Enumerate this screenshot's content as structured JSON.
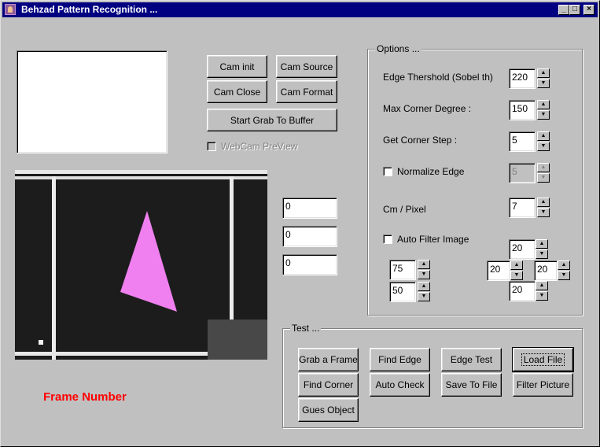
{
  "window": {
    "title": "Behzad Pattern Recognition ...",
    "controls": {
      "minimize": "_",
      "maximize": "□",
      "close": "×"
    }
  },
  "camera": {
    "buttons": {
      "init": "Cam init",
      "source": "Cam Source",
      "close": "Cam Close",
      "format": "Cam Format",
      "grab": "Start Grab To Buffer"
    },
    "preview_label": "WebCam PreView",
    "preview_checked": false
  },
  "readouts": [
    "0",
    "0",
    "0"
  ],
  "frame_label": "Frame Number",
  "image": {
    "shape_color": "#f080f0",
    "background": "#1a1a1a",
    "lines": "#f0f0f0",
    "patch": "#484848"
  },
  "options": {
    "title": "Options ...",
    "edge_threshold": {
      "label": "Edge Thershold (Sobel th)",
      "value": "220"
    },
    "max_corner": {
      "label": "Max Corner Degree :",
      "value": "150"
    },
    "corner_step": {
      "label": "Get Corner Step :",
      "value": "5"
    },
    "normalize": {
      "label": "Normalize Edge",
      "value": "5",
      "checked": false
    },
    "cm_pixel": {
      "label": "Cm / Pixel",
      "value": "7"
    },
    "auto_filter": {
      "label": "Auto Filter Image",
      "checked": false
    },
    "filter_left": [
      "75",
      "50"
    ],
    "filter_cross": {
      "top": "20",
      "left": "20",
      "right": "20",
      "bottom": "20"
    }
  },
  "test": {
    "title": "Test ...",
    "buttons": {
      "grab_frame": "Grab a Frame",
      "find_edge": "Find Edge",
      "edge_test": "Edge Test",
      "load_file": "Load File",
      "find_corner": "Find Corner",
      "auto_check": "Auto Check",
      "save_to_file": "Save To File",
      "filter_picture": "Filter Picture",
      "gues_object": "Gues Object"
    }
  },
  "spinner": {
    "up": "▲",
    "down": "▼"
  }
}
